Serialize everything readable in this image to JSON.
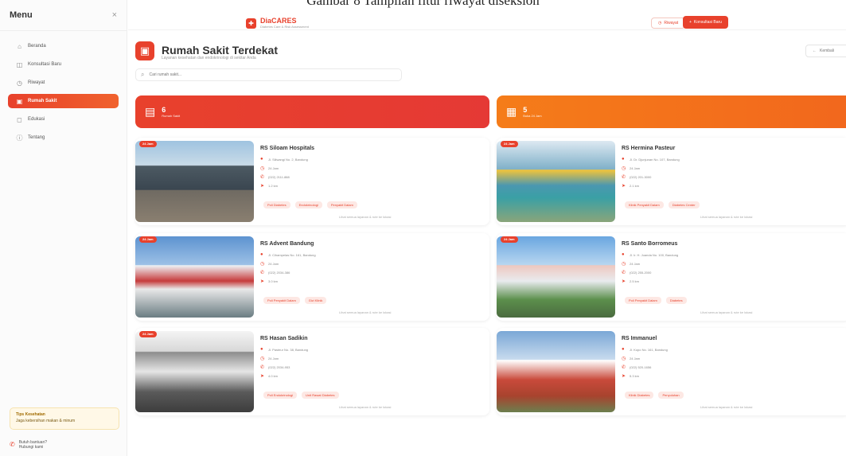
{
  "caption": "Gambar 8 Tampilan fitur riwayat diseksion",
  "sidebar": {
    "title": "Menu",
    "close": "×",
    "items": [
      {
        "label": "Beranda",
        "icon": "home-icon",
        "glyph": "⌂"
      },
      {
        "label": "Konsultasi Baru",
        "icon": "chat-icon",
        "glyph": "◫"
      },
      {
        "label": "Riwayat",
        "icon": "clock-icon",
        "glyph": "◷"
      },
      {
        "label": "Rumah Sakit",
        "icon": "hospital-icon",
        "glyph": "▣"
      },
      {
        "label": "Edukasi",
        "icon": "book-icon",
        "glyph": "◻"
      },
      {
        "label": "Tentang",
        "icon": "info-icon",
        "glyph": "ⓘ"
      }
    ],
    "tip_title": "Tips Kesehatan",
    "tip_text": "Jaga kebersihan makan & minum",
    "contact_label": "Butuh bantuan?",
    "contact_sub": "Hubungi kami"
  },
  "header": {
    "brand": "DiaCARES",
    "brand_sub": "Diabetes Care & Risk Assessment",
    "history_button": "Riwayat",
    "new_button": "Konsultasi Baru"
  },
  "page": {
    "title": "Rumah Sakit Terdekat",
    "subtitle": "Layanan kesehatan dan endokrinologi di sekitar Anda",
    "action": "Kembali",
    "search_placeholder": "Cari rumah sakit..."
  },
  "stats": [
    {
      "value": "6",
      "label": "Rumah Sakit",
      "icon": "hospital-icon"
    },
    {
      "value": "5",
      "label": "Buka 24 Jam",
      "icon": "building-icon"
    }
  ],
  "hospitals": [
    {
      "name": "RS Siloam Hospitals",
      "address": "Jl. Siliwangi No. 2, Bandung",
      "hours": "24 Jam",
      "phone": "(022) 2111-888",
      "distance": "1.2 km",
      "badge": "24 Jam",
      "tags": [
        "Poli Diabetes",
        "Endokrinologi",
        "Penyakit Dalam"
      ],
      "more": "Lihat semua layanan & rute ke lokasi"
    },
    {
      "name": "RS Hermina Pasteur",
      "address": "Jl. Dr. Djunjunan No. 107, Bandung",
      "hours": "24 Jam",
      "phone": "(022) 201-3000",
      "distance": "2.1 km",
      "badge": "24 Jam",
      "tags": [
        "Klinik Penyakit Dalam",
        "Diabetes Center"
      ],
      "more": "Lihat semua layanan & rute ke lokasi"
    },
    {
      "name": "RS Advent Bandung",
      "address": "Jl. Cihampelas No. 161, Bandung",
      "hours": "24 Jam",
      "phone": "(022) 2034-386",
      "distance": "3.0 km",
      "badge": "24 Jam",
      "tags": [
        "Poli Penyakit Dalam",
        "Gizi Klinik"
      ],
      "more": "Lihat semua layanan & rute ke lokasi"
    },
    {
      "name": "RS Santo Borromeus",
      "address": "Jl. Ir. H. Juanda No. 100, Bandung",
      "hours": "24 Jam",
      "phone": "(022) 255-2000",
      "distance": "2.5 km",
      "badge": "24 Jam",
      "tags": [
        "Poli Penyakit Dalam",
        "Diabetes"
      ],
      "more": "Lihat semua layanan & rute ke lokasi"
    },
    {
      "name": "RS Hasan Sadikin",
      "address": "Jl. Pasteur No. 38, Bandung",
      "hours": "24 Jam",
      "phone": "(022) 2034-953",
      "distance": "4.0 km",
      "badge": "24 Jam",
      "tags": [
        "Poli Endokrinologi",
        "Unit Rawat Diabetes"
      ],
      "more": "Lihat semua layanan & rute ke lokasi"
    },
    {
      "name": "RS Immanuel",
      "address": "Jl. Kopo No. 161, Bandung",
      "hours": "24 Jam",
      "phone": "(022) 520-1656",
      "distance": "5.3 km",
      "badge": "",
      "tags": [
        "Klinik Diabetes",
        "Penyuluhan"
      ],
      "more": "Lihat semua layanan & rute ke lokasi"
    }
  ],
  "colors": {
    "primary": "#e8412c",
    "secondary": "#f57c19"
  }
}
